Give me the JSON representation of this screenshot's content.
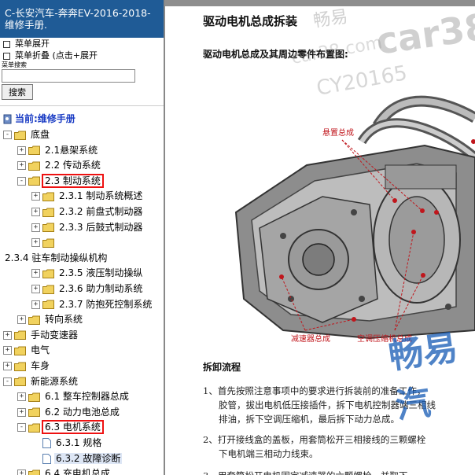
{
  "sidebar": {
    "title": "C-长安汽车-奔奔EV-2016-2018- 维修手册.",
    "menu_expand": "菜单展开",
    "menu_collapse": "菜单折叠 (点击+展开",
    "search_label": "菜单搜索",
    "search_value": "",
    "search_button": "搜索",
    "current_label": "当前:维修手册",
    "tree": [
      {
        "id": "chassis",
        "label": "底盘",
        "level": 0,
        "pm": "-",
        "icon": "folder"
      },
      {
        "id": "2-1",
        "label": "2.1悬架系统",
        "level": 1,
        "pm": "+",
        "icon": "folder"
      },
      {
        "id": "2-2",
        "label": "2.2 传动系统",
        "level": 1,
        "pm": "+",
        "icon": "folder"
      },
      {
        "id": "2-3",
        "label": "2.3 制动系统",
        "level": 1,
        "pm": "-",
        "icon": "folder",
        "highlight": true
      },
      {
        "id": "2-3-1",
        "label": "2.3.1 制动系统概述",
        "level": 2,
        "pm": "+",
        "icon": "folder"
      },
      {
        "id": "2-3-2",
        "label": "2.3.2 前盘式制动器",
        "level": 2,
        "pm": "+",
        "icon": "folder"
      },
      {
        "id": "2-3-3",
        "label": "2.3.3 后鼓式制动器",
        "level": 2,
        "pm": "+",
        "icon": "folder"
      },
      {
        "id": "blank",
        "label": "",
        "level": 2,
        "pm": "+",
        "icon": "folder"
      },
      {
        "id": "2-3-4",
        "label": "2.3.4 驻车制动操纵机构",
        "level": -1,
        "pm": "",
        "icon": "none"
      },
      {
        "id": "2-3-5",
        "label": "2.3.5 液压制动操纵",
        "level": 2,
        "pm": "+",
        "icon": "folder"
      },
      {
        "id": "2-3-6",
        "label": "2.3.6 助力制动系统",
        "level": 2,
        "pm": "+",
        "icon": "folder"
      },
      {
        "id": "2-3-7",
        "label": "2.3.7 防抱死控制系统",
        "level": 2,
        "pm": "+",
        "icon": "folder"
      },
      {
        "id": "steer",
        "label": "转向系统",
        "level": 1,
        "pm": "+",
        "icon": "folder"
      },
      {
        "id": "manual",
        "label": "手动变速器",
        "level": 0,
        "pm": "+",
        "icon": "folder"
      },
      {
        "id": "elec",
        "label": "电气",
        "level": 0,
        "pm": "+",
        "icon": "folder"
      },
      {
        "id": "body",
        "label": "车身",
        "level": 0,
        "pm": "+",
        "icon": "folder"
      },
      {
        "id": "newenergy",
        "label": "新能源系统",
        "level": 0,
        "pm": "-",
        "icon": "folder"
      },
      {
        "id": "6-1",
        "label": "6.1 整车控制器总成",
        "level": 1,
        "pm": "+",
        "icon": "folder"
      },
      {
        "id": "6-2",
        "label": "6.2 动力电池总成",
        "level": 1,
        "pm": "+",
        "icon": "folder"
      },
      {
        "id": "6-3",
        "label": "6.3 电机系统",
        "level": 1,
        "pm": "-",
        "icon": "folder",
        "highlight": true
      },
      {
        "id": "6-3-1",
        "label": "6.3.1 规格",
        "level": 2,
        "pm": "",
        "icon": "doc"
      },
      {
        "id": "6-3-2",
        "label": "6.3.2 故障诊断",
        "level": 2,
        "pm": "",
        "icon": "doc",
        "selected": true
      },
      {
        "id": "6-4",
        "label": "6.4 充电机总成",
        "level": 1,
        "pm": "+",
        "icon": "folder"
      }
    ]
  },
  "content": {
    "heading": "驱动电机总成拆装",
    "subheading": "驱动电机总成及其周边零件布置图:",
    "figure": {
      "labels": {
        "suspension": "悬置总成",
        "reducer": "减速器总成",
        "ac_compressor": "空调压缩机总成"
      }
    },
    "procedure_heading": "拆卸流程",
    "steps": [
      {
        "lines": [
          "1、首先按照注意事项中的要求进行拆装前的准备工作，",
          "胶管，拔出电机低压接插件，拆下电机控制器端三相线",
          "排油，拆下空调压缩机，最后拆下动力总成。"
        ]
      },
      {
        "lines": [
          "2、打开接线盒的盖板，用套筒松开三相接线的三颗螺栓",
          "下电机端三相动力线束。"
        ]
      },
      {
        "lines": [
          "3、用套筒松开电机固定减速器的六颗螺栓，并取下"
        ]
      }
    ],
    "watermarks": [
      "畅易",
      "car38",
      "car38.com",
      "CY20165",
      "畅易汽"
    ]
  },
  "colors": {
    "title_bg": "#1f5b96",
    "highlight_box": "#e11111",
    "current_link": "#1a3cc4",
    "figure_label": "#c0161c"
  }
}
